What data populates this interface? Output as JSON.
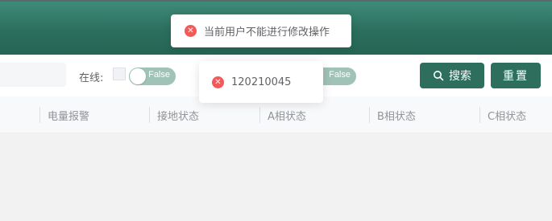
{
  "filters": {
    "online_label": "在线:",
    "toggle1": "False",
    "toggle2": "False"
  },
  "buttons": {
    "search": "搜索",
    "reset": "重置"
  },
  "table": {
    "columns": [
      "电量报警",
      "接地状态",
      "A相状态",
      "B相状态",
      "C相状态"
    ]
  },
  "toasts": [
    {
      "message": "当前用户不能进行修改操作",
      "icon": "error-icon"
    },
    {
      "message": "120210045",
      "icon": "error-icon"
    }
  ],
  "colors": {
    "brand": "#2d6e5d",
    "toggle": "#9fc3b6",
    "error": "#f25a5a"
  }
}
